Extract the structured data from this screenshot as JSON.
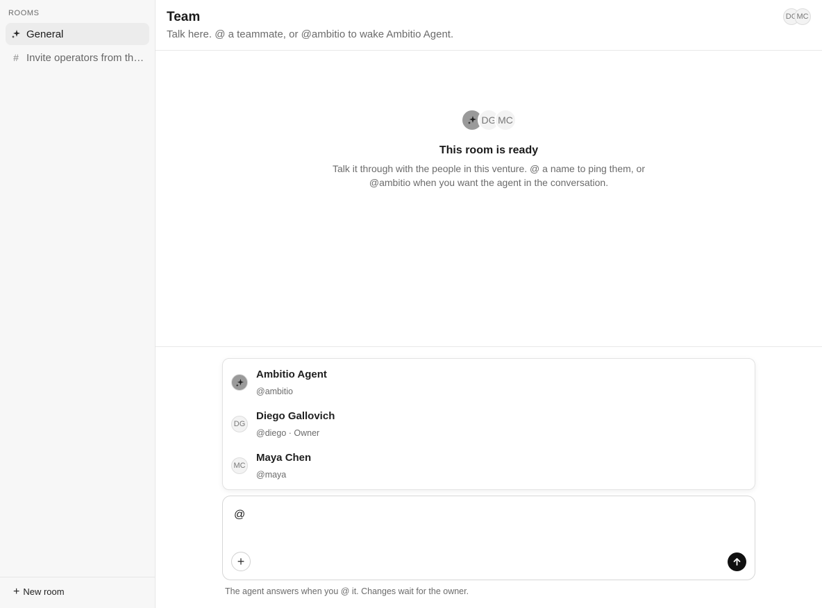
{
  "sidebar": {
    "section_label": "ROOMS",
    "rooms": [
      {
        "label": "General",
        "icon": "sparkle-icon",
        "active": true
      },
      {
        "label": "Invite operators from the network",
        "icon": "hash-icon",
        "active": false
      }
    ],
    "new_room_label": "New room"
  },
  "header": {
    "title": "Team",
    "subtitle": "Talk here. @ a teammate, or @ambitio to wake Ambitio Agent.",
    "avatars": [
      "DG",
      "MC"
    ]
  },
  "empty_state": {
    "avatars": [
      "DG",
      "MC"
    ],
    "title": "This room is ready",
    "description": "Talk it through with the people in this venture. @ a name to ping them, or @ambitio when you want the agent in the conversation."
  },
  "mentions": [
    {
      "initials": "",
      "name": "Ambitio Agent",
      "handle": "@ambitio",
      "is_agent": true
    },
    {
      "initials": "DG",
      "name": "Diego Gallovich",
      "handle": "@diego · Owner",
      "is_agent": false
    },
    {
      "initials": "MC",
      "name": "Maya Chen",
      "handle": "@maya",
      "is_agent": false
    }
  ],
  "composer": {
    "value": "@",
    "hint": "The agent answers when you @ it. Changes wait for the owner."
  },
  "colors": {
    "sidebar_bg": "#f7f7f7",
    "active_room_bg": "#ececec",
    "agent_avatar_bg": "#9a9a9a",
    "send_button_bg": "#111111"
  }
}
